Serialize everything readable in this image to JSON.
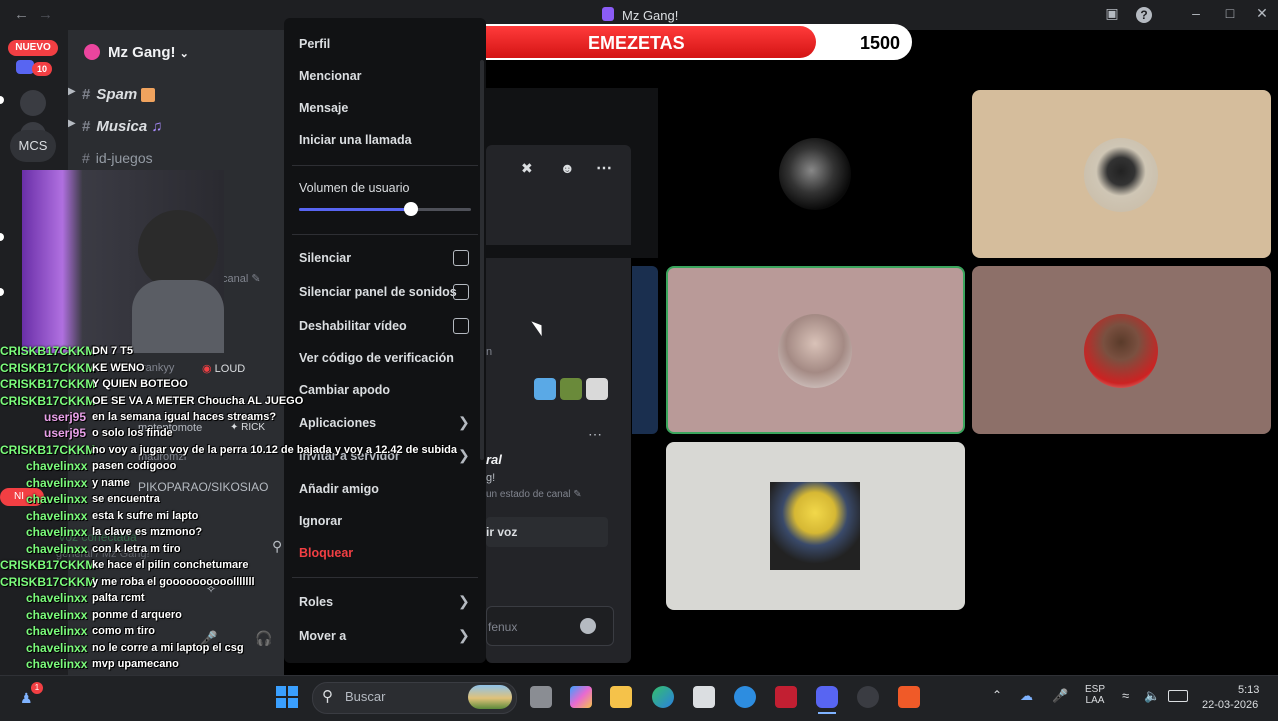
{
  "window": {
    "title": "Mz Gang!"
  },
  "rail": {
    "new_badge": "NUEVO",
    "new_count": "10",
    "server_label": "MCS"
  },
  "server": {
    "name": "Mz Gang!",
    "channels": [
      {
        "name": "Spam"
      },
      {
        "name": "Musica"
      },
      {
        "name": "id-juegos"
      }
    ],
    "hint_canal": "canal",
    "member_names": [
      "rankyy",
      "LOUD",
      "moteptomote",
      "RICK",
      "mauromzr",
      "PIKOPARAO/SIKOSIAO"
    ],
    "voice_connected": "Voz conectada",
    "voice_channel": "general / Mz Gang!",
    "side_badge": "NI"
  },
  "progress": {
    "current": "1239",
    "label": "EMEZETAS",
    "goal": "1500",
    "fraction": 0.826,
    "color": "#e01f1f"
  },
  "context_menu": {
    "items": [
      "Perfil",
      "Mencionar",
      "Mensaje",
      "Iniciar una llamada"
    ],
    "volume_label": "Volumen de usuario",
    "volume_fraction": 0.65,
    "checks": [
      {
        "label": "Silenciar",
        "checked": false
      },
      {
        "label": "Silenciar panel de sonidos",
        "checked": false
      },
      {
        "label": "Deshabilitar vídeo",
        "checked": false
      }
    ],
    "items2": [
      "Ver código de verificación",
      "Cambiar apodo"
    ],
    "apps": "Aplicaciones",
    "invite": "Invitar a servidor",
    "add_friend": "Añadir amigo",
    "ignore": "Ignorar",
    "block": "Bloquear",
    "roles": "Roles",
    "move": "Mover a"
  },
  "middle_panel": {
    "status_hint": "un estado de canal",
    "voice_btn": "ir voz",
    "input_hint": "fenux",
    "fragment_n": "n",
    "fragment_ral": "ral",
    "fragment_g": "g!"
  },
  "chat": [
    {
      "user": "CRISKB17CKKM",
      "msg": "DN 7 T5"
    },
    {
      "user": "CRISKB17CKKM",
      "msg": "KE WENO"
    },
    {
      "user": "CRISKB17CKKM",
      "msg": "Y QUIEN BOTEOO"
    },
    {
      "user": "CRISKB17CKKM",
      "msg": "OE SE VA A METER Choucha AL JUEGO"
    },
    {
      "user": "userj95",
      "msg": "en la semana igual haces streams?"
    },
    {
      "user": "userj95",
      "msg": "o solo los finde"
    },
    {
      "user": "CRISKB17CKKM",
      "msg": "no voy a jugar voy de la perra 10.12 de bajada y voy a 12.42 de subida"
    },
    {
      "user": "chavelinxx",
      "msg": "pasen codigooo"
    },
    {
      "user": "chavelinxx",
      "msg": "y name"
    },
    {
      "user": "chavelinxx",
      "msg": "se encuentra"
    },
    {
      "user": "chavelinxx",
      "msg": "esta k sufre mi lapto"
    },
    {
      "user": "chavelinxx",
      "msg": "la clave es mzmono?"
    },
    {
      "user": "chavelinxx",
      "msg": "con k letra m tiro"
    },
    {
      "user": "CRISKB17CKKM",
      "msg": "ke hace el pilin conchetumare"
    },
    {
      "user": "CRISKB17CKKM",
      "msg": "y me roba el goooooooooolllllll"
    },
    {
      "user": "chavelinxx",
      "msg": "palta rcmt"
    },
    {
      "user": "chavelinxx",
      "msg": "ponme d arquero"
    },
    {
      "user": "chavelinxx",
      "msg": "como m tiro"
    },
    {
      "user": "chavelinxx",
      "msg": "no le corre a mi laptop el csg"
    },
    {
      "user": "chavelinxx",
      "msg": "mvp upamecano"
    }
  ],
  "taskbar": {
    "search_placeholder": "Buscar",
    "lang": "ESP",
    "lang2": "LAA",
    "time": "5:13",
    "date": "22-03-2026",
    "notif_count": "1"
  },
  "colors": {
    "accent_green": "#3ba55d",
    "block_red": "#f23f43",
    "slider_blue": "#5865f2"
  }
}
